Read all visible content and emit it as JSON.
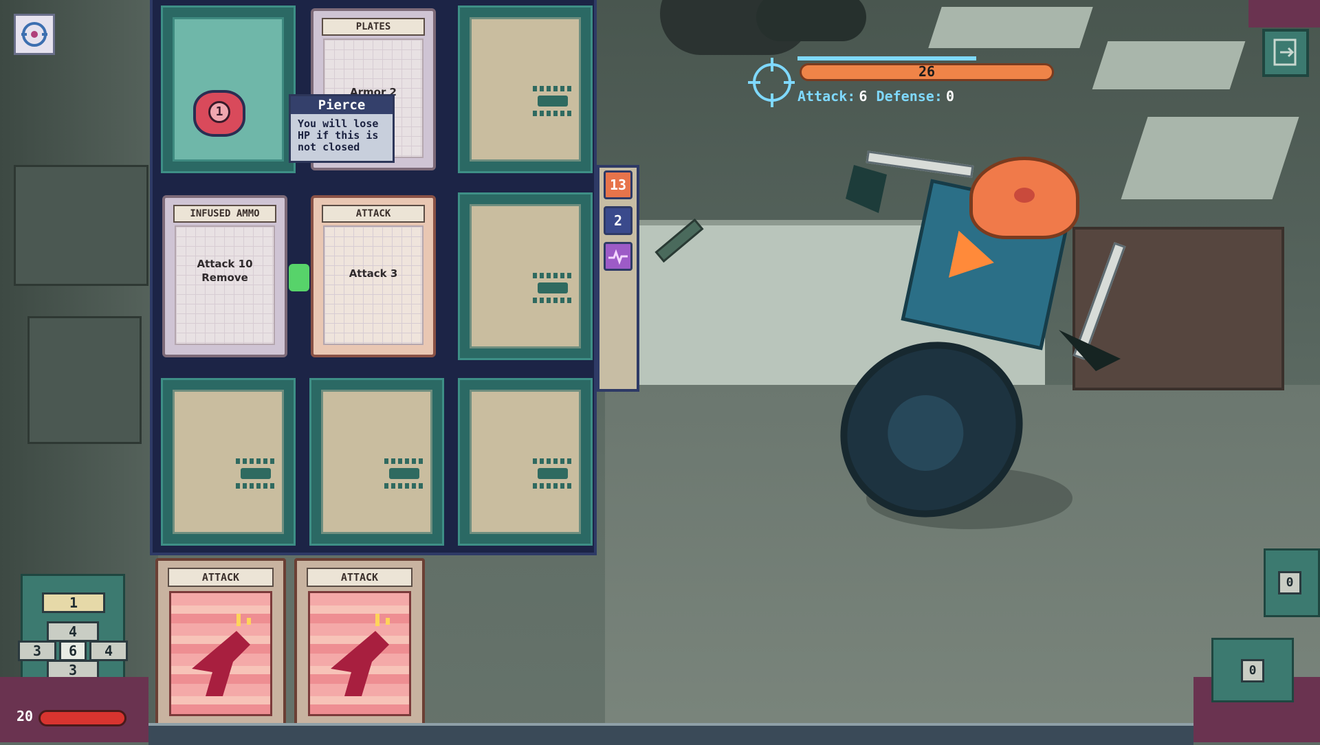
{
  "hud": {
    "menu_icon": "settings-gear-icon",
    "exit_icon": "exit-door-icon"
  },
  "board": {
    "top_left_token": {
      "value": "1",
      "icon": "pierce-token-icon"
    },
    "plates_card": {
      "title": "PLATES",
      "text": "Armor 2"
    },
    "infused_ammo_card": {
      "title": "INFUSED AMMO",
      "line1": "Attack 10",
      "line2": "Remove"
    },
    "attack_card": {
      "title": "ATTACK",
      "text": "Attack 3"
    }
  },
  "tooltip": {
    "title": "Pierce",
    "line1": "You will lose",
    "line2": "HP if this is",
    "line3": "not closed"
  },
  "side_column": {
    "badge_orange": "13",
    "badge_blue": "2",
    "badge_purple_icon": "heartbeat-icon"
  },
  "hand": [
    {
      "title": "ATTACK",
      "icon": "pistol-icon"
    },
    {
      "title": "ATTACK",
      "icon": "pistol-icon"
    }
  ],
  "enemy": {
    "hp": "26",
    "attack_label": "Attack:",
    "attack_value": "6",
    "defense_label": "Defense:",
    "defense_value": "0",
    "target_icon": "crosshair-icon"
  },
  "player": {
    "energy": "1",
    "top": "4",
    "left": "3",
    "center": "6",
    "right": "4",
    "bottom": "3",
    "hp": "20"
  },
  "counters": {
    "right_mid": "0",
    "right_bottom": "0"
  },
  "colors": {
    "board_bg": "#1c2446",
    "slot_teal": "#2b6964",
    "enemy_hp": "#ef8448",
    "player_hp": "#d8342f",
    "attack_text": "#7fd9ff"
  }
}
